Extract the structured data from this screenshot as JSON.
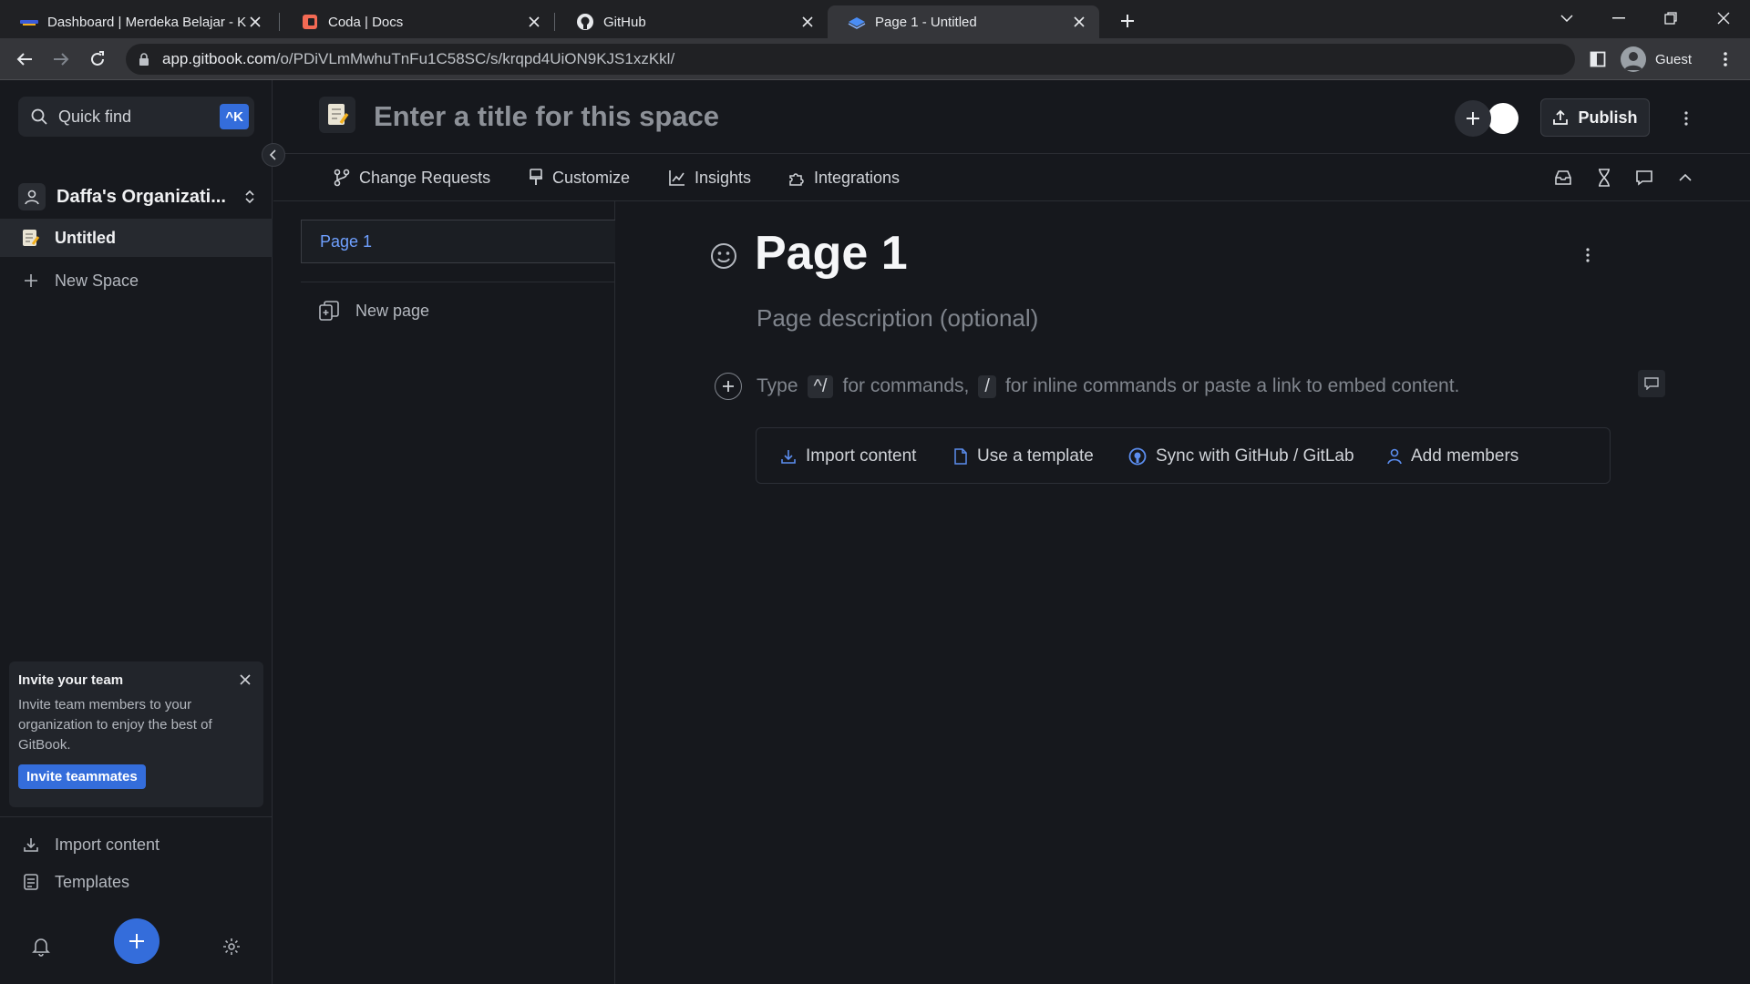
{
  "browser": {
    "tabs": [
      {
        "title": "Dashboard | Merdeka Belajar - Ka",
        "icon": "merdeka-favicon"
      },
      {
        "title": "Coda | Docs",
        "icon": "coda-favicon"
      },
      {
        "title": "GitHub",
        "icon": "github-favicon"
      },
      {
        "title": "Page 1 - Untitled",
        "icon": "gitbook-favicon",
        "active": true
      }
    ],
    "url_host": "app.gitbook.com",
    "url_path": "/o/PDiVLmMwhuTnFu1C58SC/s/krqpd4UiON9KJS1xzKkl/",
    "profile_label": "Guest"
  },
  "sidebar": {
    "quick_find": "Quick find",
    "quick_find_shortcut": "^K",
    "org_name": "Daffa's Organizati...",
    "space_name": "Untitled",
    "new_space": "New Space",
    "invite": {
      "title": "Invite your team",
      "body": "Invite team members to your organization to enjoy the best of GitBook.",
      "button": "Invite teammates"
    },
    "import_content": "Import content",
    "templates": "Templates"
  },
  "header": {
    "title_placeholder": "Enter a title for this space",
    "publish": "Publish",
    "toolbar": {
      "change_requests": "Change Requests",
      "customize": "Customize",
      "insights": "Insights",
      "integrations": "Integrations"
    }
  },
  "tree": {
    "current_page": "Page 1",
    "new_page": "New page"
  },
  "editor": {
    "page_title": "Page 1",
    "description_placeholder": "Page description (optional)",
    "hint_type": "Type",
    "hint_key1": "^/",
    "hint_mid": "for commands,",
    "hint_key2": "/",
    "hint_end": "for inline commands or paste a link to embed content.",
    "actions": {
      "import": "Import content",
      "template": "Use a template",
      "sync": "Sync with GitHub / GitLab",
      "members": "Add members"
    }
  },
  "colors": {
    "accent": "#346ddb",
    "link": "#6fa0ff",
    "background": "#16181d"
  }
}
